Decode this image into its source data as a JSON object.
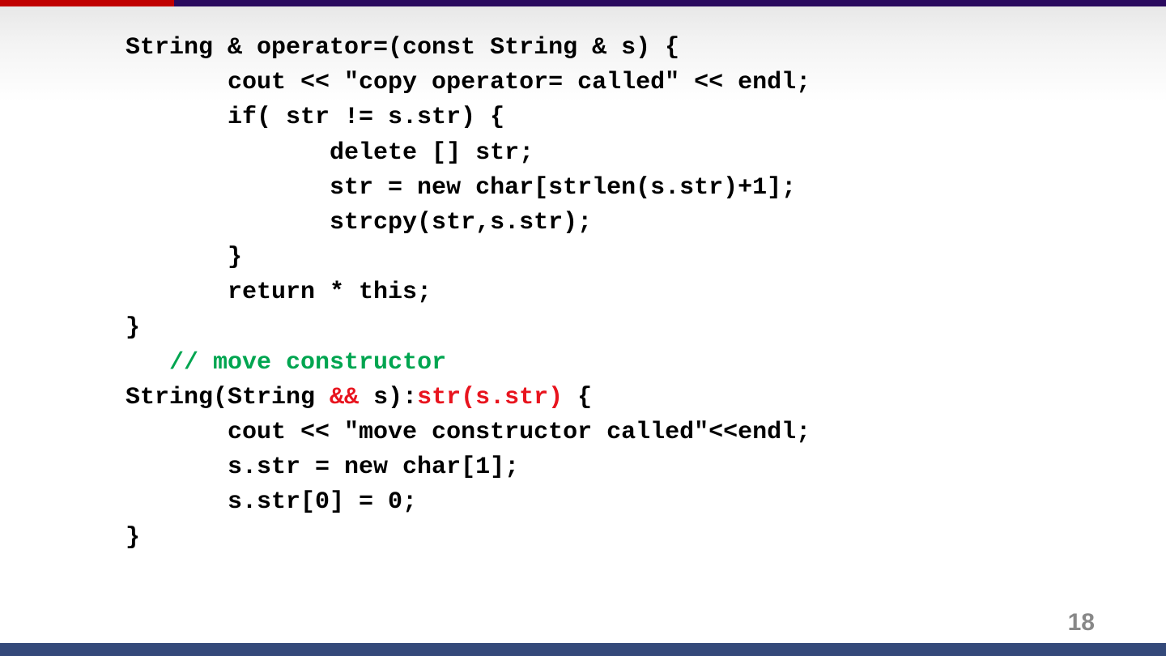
{
  "colors": {
    "top_bar_red": "#c00000",
    "top_bar_purple": "#2a0a5e",
    "bottom_bar": "#34497a",
    "keyword_red": "#e8141e",
    "comment_green": "#00a550",
    "page_number": "#888888"
  },
  "slide": {
    "page_number": "18"
  },
  "code": {
    "lines": [
      [
        "String & operator=(const String & s) {"
      ],
      [
        "       cout << \"copy operator= called\" << endl;"
      ],
      [
        "       if( str != s.str) {"
      ],
      [
        "              delete [] str;"
      ],
      [
        "              str = new char[strlen(s.str)+1];"
      ],
      [
        "              strcpy(str,s.str);"
      ],
      [
        "       }"
      ],
      [
        "       return * this;"
      ],
      [
        "}"
      ],
      [
        "   ",
        "// move constructor"
      ],
      [
        "String(String ",
        "&&",
        " s):",
        "str(s.str)",
        " {"
      ],
      [
        "       cout << \"move constructor called\"<<endl;"
      ],
      [
        "       s.str = new char[1];"
      ],
      [
        "       s.str[0] = 0;"
      ],
      [
        "}"
      ]
    ]
  }
}
